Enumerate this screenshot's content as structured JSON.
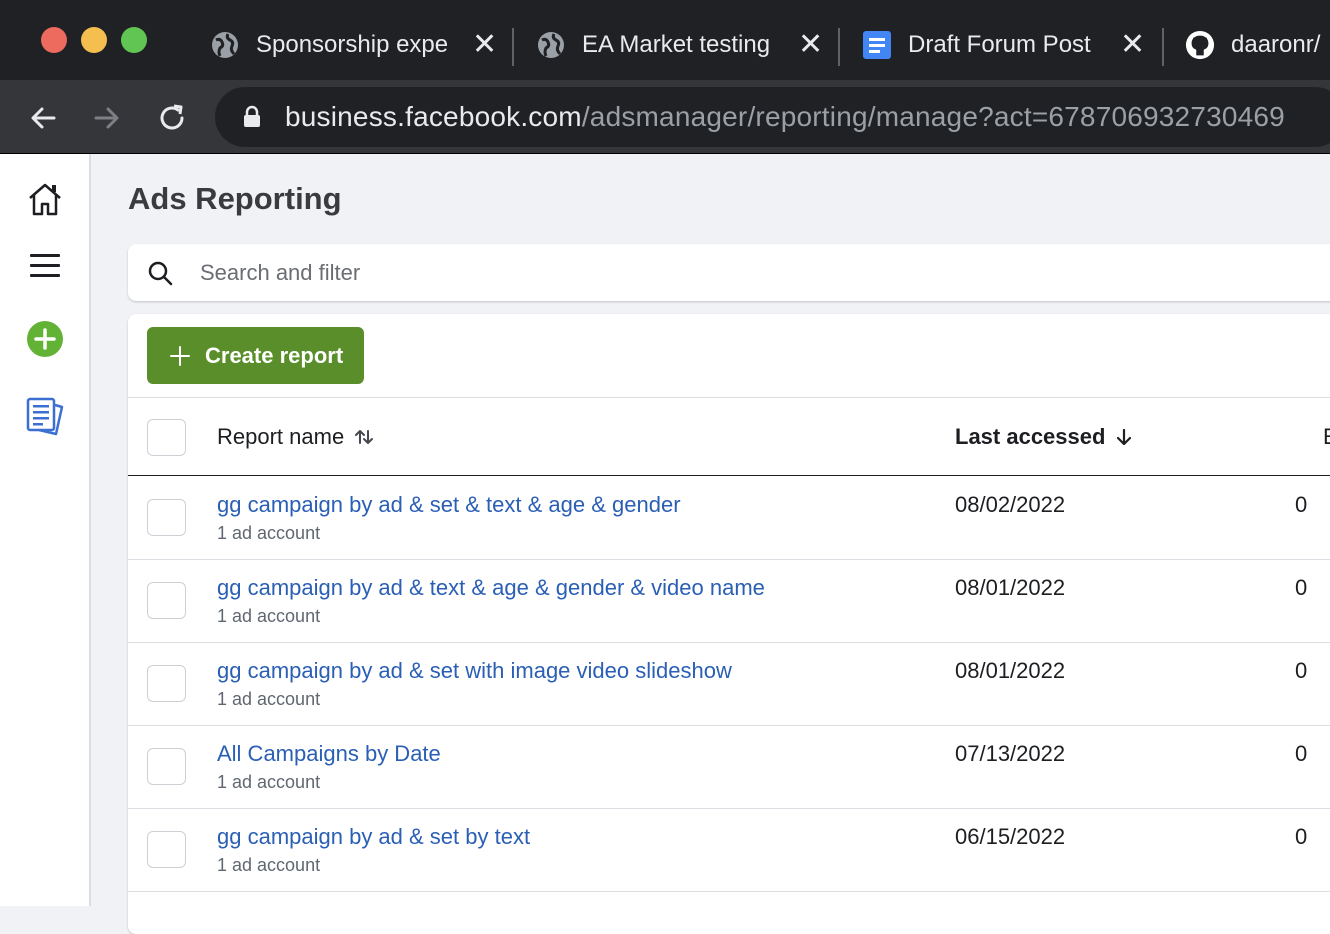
{
  "browser": {
    "tabs": [
      {
        "title": "Sponsorship expe",
        "icon": "globe-icon"
      },
      {
        "title": "EA Market testing",
        "icon": "globe-icon"
      },
      {
        "title": "Draft Forum Post",
        "icon": "google-docs-icon"
      },
      {
        "title": "daaronr/",
        "icon": "github-icon"
      }
    ],
    "url_host": "business.facebook.com",
    "url_path": "/adsmanager/reporting/manage?act=678706932730469"
  },
  "page": {
    "title": "Ads Reporting"
  },
  "search": {
    "placeholder": "Search and filter",
    "value": ""
  },
  "toolbar": {
    "create_label": "Create report"
  },
  "table": {
    "columns": [
      {
        "label": "Report name",
        "sort": "both"
      },
      {
        "label": "Last accessed",
        "sort": "desc"
      },
      {
        "label": "E"
      }
    ],
    "rows": [
      {
        "name": "gg campaign by ad & set & text & age & gender",
        "sub": "1 ad account",
        "last_accessed": "08/02/2022",
        "next_col": "0"
      },
      {
        "name": "gg campaign by ad & text & age & gender & video name",
        "sub": "1 ad account",
        "last_accessed": "08/01/2022",
        "next_col": "0"
      },
      {
        "name": "gg campaign by ad & set with image video slideshow",
        "sub": "1 ad account",
        "last_accessed": "08/01/2022",
        "next_col": "0"
      },
      {
        "name": "All Campaigns by Date",
        "sub": "1 ad account",
        "last_accessed": "07/13/2022",
        "next_col": "0"
      },
      {
        "name": "gg campaign by ad & set by text",
        "sub": "1 ad account",
        "last_accessed": "06/15/2022",
        "next_col": "0"
      }
    ]
  },
  "rail": {
    "items": [
      "home-icon",
      "menu-icon",
      "create-icon",
      "reports-icon"
    ]
  },
  "colors": {
    "accent_green": "#5a8e2a",
    "link_blue": "#2a5fb5",
    "rail_create_green": "#62b335",
    "rail_reports_blue": "#3b6fd1"
  }
}
